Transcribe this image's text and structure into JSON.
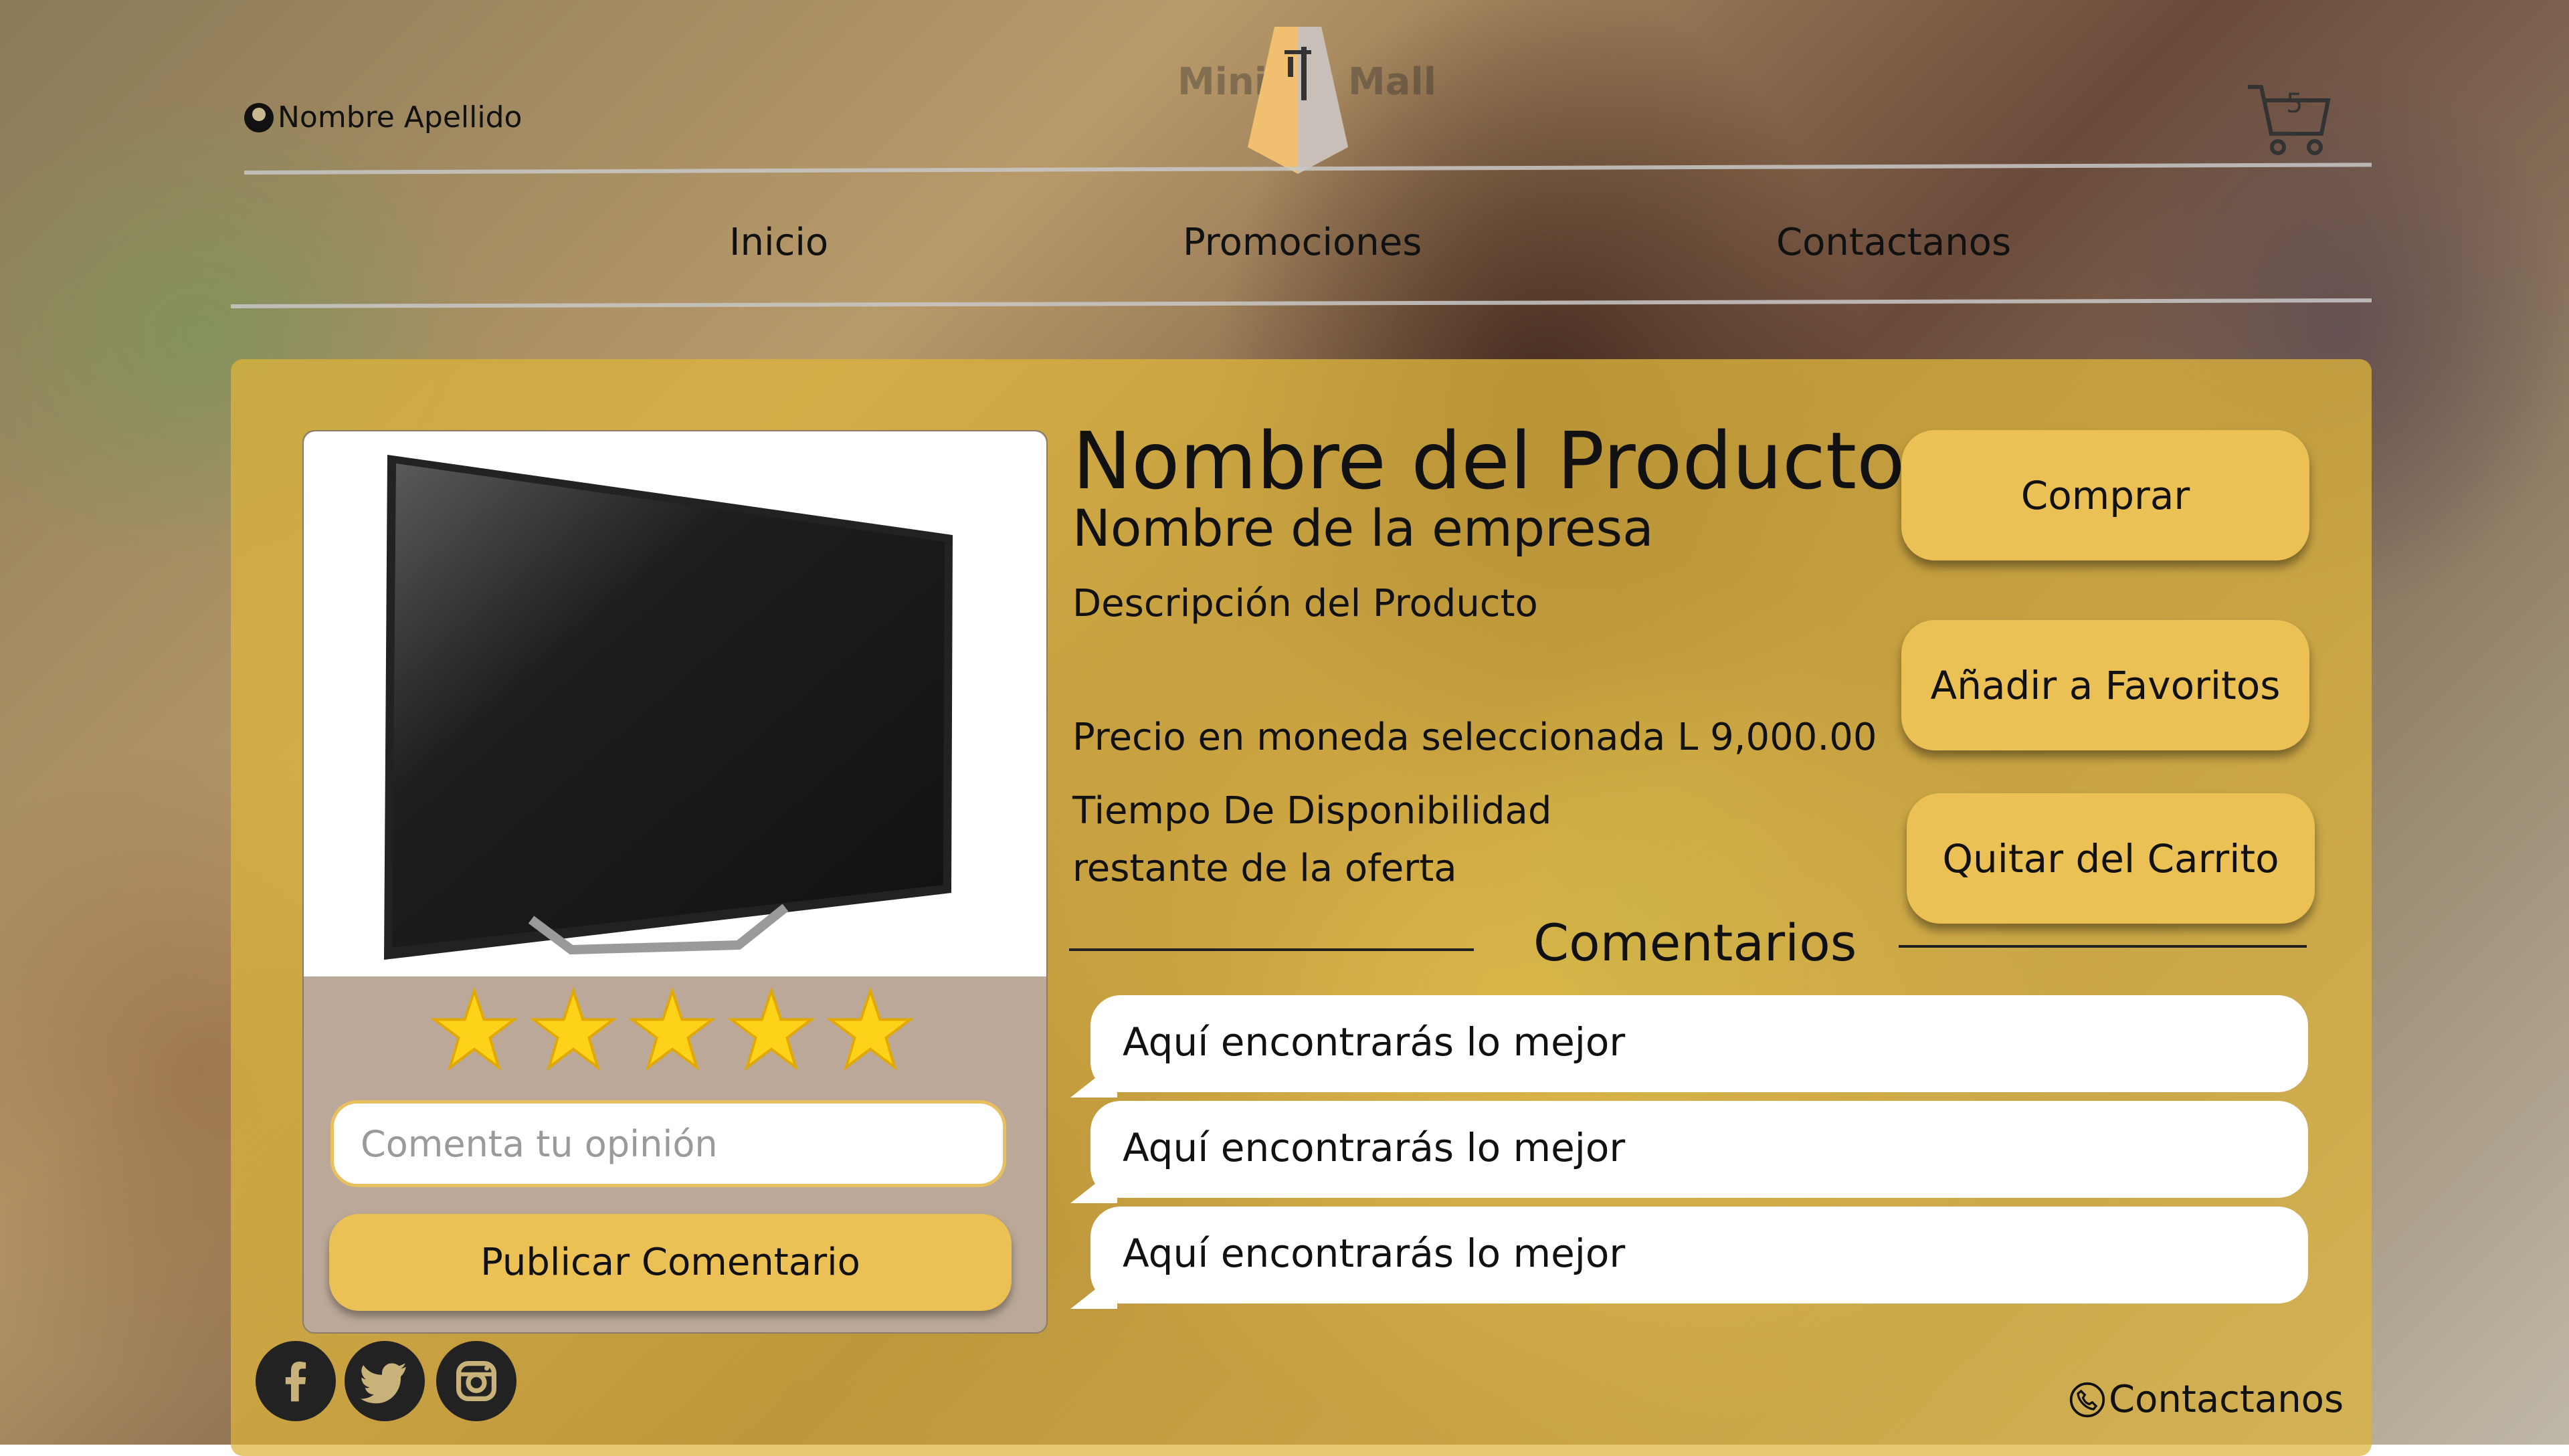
{
  "header": {
    "user_name": "Nombre Apellido",
    "logo_left": "Mini",
    "logo_right": "Mall",
    "cart_count": "5"
  },
  "nav": {
    "items": [
      "Inicio",
      "Promociones",
      "Contactanos"
    ]
  },
  "product": {
    "title": "Nombre del Producto",
    "company": "Nombre de la empresa",
    "description": "Descripción del Producto",
    "price": "Precio en moneda seleccionada L 9,000.00",
    "availability_line1": "Tiempo De Disponibilidad",
    "availability_line2": "restante de la oferta",
    "rating_stars": 5
  },
  "actions": {
    "buy": "Comprar",
    "favorite": "Añadir a Favoritos",
    "remove_cart": "Quitar del Carrito"
  },
  "comment_form": {
    "placeholder": "Comenta tu opinión",
    "publish": "Publicar Comentario"
  },
  "comments": {
    "title": "Comentarios",
    "items": [
      "Aquí encontrarás lo mejor",
      "Aquí encontrarás lo mejor",
      "Aquí encontrarás lo mejor"
    ]
  },
  "footer": {
    "social_icons": [
      "facebook-icon",
      "twitter-icon",
      "instagram-icon"
    ],
    "contact": "Contactanos"
  },
  "colors": {
    "accent": "#ebc055",
    "panel": "#dab23c"
  }
}
